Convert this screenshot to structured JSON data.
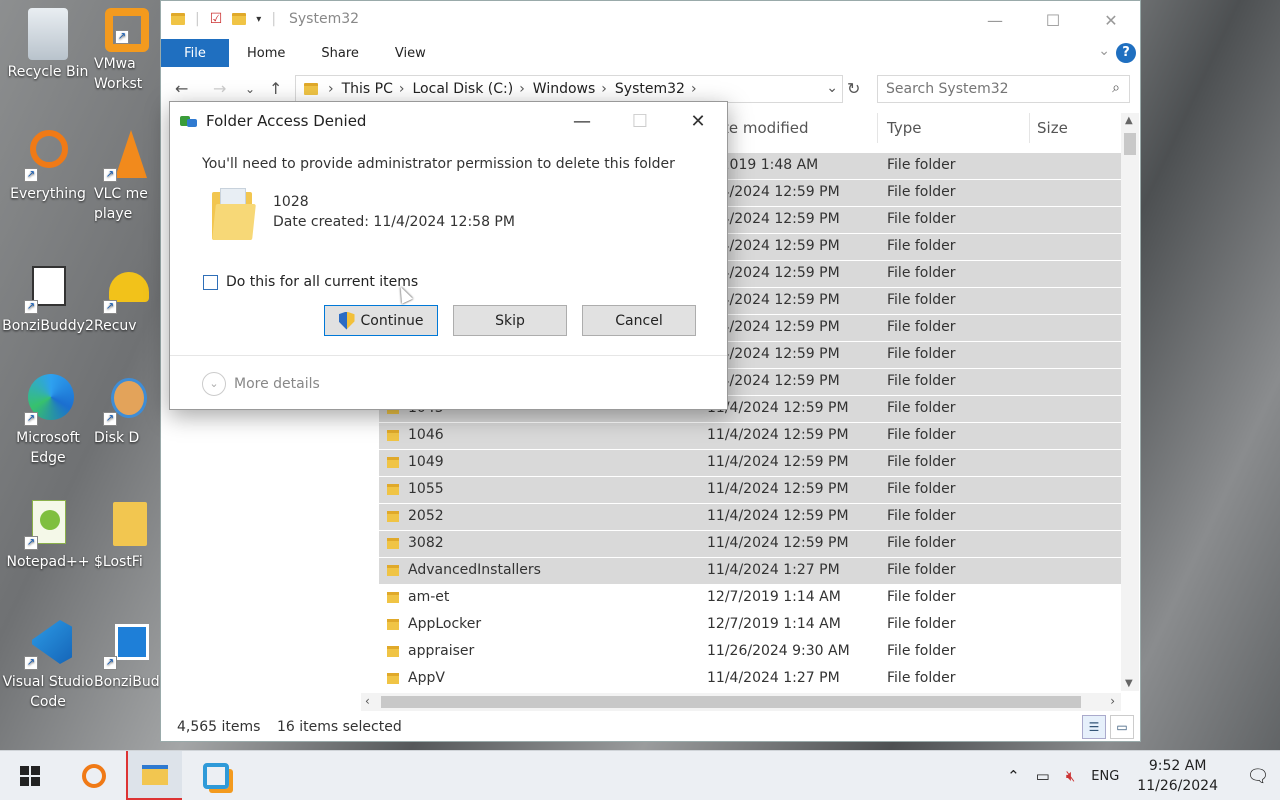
{
  "desktop": {
    "icons": [
      {
        "label": "Recycle Bin"
      },
      {
        "label": "VMwa Workst"
      },
      {
        "label": "Everything"
      },
      {
        "label": "VLC me playe"
      },
      {
        "label": "BonziBuddy2"
      },
      {
        "label": "Recuv"
      },
      {
        "label": "Microsoft Edge"
      },
      {
        "label": "Disk D"
      },
      {
        "label": "Notepad++"
      },
      {
        "label": "$LostFi"
      },
      {
        "label": "Visual Studio Code"
      },
      {
        "label": "BonziBud"
      }
    ]
  },
  "explorer": {
    "title": "System32",
    "ribbon": {
      "file": "File",
      "home": "Home",
      "share": "Share",
      "view": "View"
    },
    "breadcrumb": [
      "This PC",
      "Local Disk (C:)",
      "Windows",
      "System32"
    ],
    "search_placeholder": "Search System32",
    "columns": {
      "date": "te modified",
      "type": "Type",
      "size": "Size"
    },
    "rows": [
      {
        "name": "",
        "date": "7/2019 1:48 AM",
        "type": "File folder",
        "selected": true
      },
      {
        "name": "",
        "date": "1/4/2024 12:59 PM",
        "type": "File folder",
        "selected": true
      },
      {
        "name": "",
        "date": "1/4/2024 12:59 PM",
        "type": "File folder",
        "selected": true
      },
      {
        "name": "",
        "date": "1/4/2024 12:59 PM",
        "type": "File folder",
        "selected": true
      },
      {
        "name": "",
        "date": "1/4/2024 12:59 PM",
        "type": "File folder",
        "selected": true
      },
      {
        "name": "",
        "date": "1/4/2024 12:59 PM",
        "type": "File folder",
        "selected": true
      },
      {
        "name": "",
        "date": "1/4/2024 12:59 PM",
        "type": "File folder",
        "selected": true
      },
      {
        "name": "",
        "date": "1/4/2024 12:59 PM",
        "type": "File folder",
        "selected": true
      },
      {
        "name": "",
        "date": "1/4/2024 12:59 PM",
        "type": "File folder",
        "selected": true
      },
      {
        "name": "1045",
        "date": "11/4/2024 12:59 PM",
        "type": "File folder",
        "selected": true
      },
      {
        "name": "1046",
        "date": "11/4/2024 12:59 PM",
        "type": "File folder",
        "selected": true
      },
      {
        "name": "1049",
        "date": "11/4/2024 12:59 PM",
        "type": "File folder",
        "selected": true
      },
      {
        "name": "1055",
        "date": "11/4/2024 12:59 PM",
        "type": "File folder",
        "selected": true
      },
      {
        "name": "2052",
        "date": "11/4/2024 12:59 PM",
        "type": "File folder",
        "selected": true
      },
      {
        "name": "3082",
        "date": "11/4/2024 12:59 PM",
        "type": "File folder",
        "selected": true
      },
      {
        "name": "AdvancedInstallers",
        "date": "11/4/2024 1:27 PM",
        "type": "File folder",
        "selected": true
      },
      {
        "name": "am-et",
        "date": "12/7/2019 1:14 AM",
        "type": "File folder",
        "selected": false
      },
      {
        "name": "AppLocker",
        "date": "12/7/2019 1:14 AM",
        "type": "File folder",
        "selected": false
      },
      {
        "name": "appraiser",
        "date": "11/26/2024 9:30 AM",
        "type": "File folder",
        "selected": false
      },
      {
        "name": "AppV",
        "date": "11/4/2024 1:27 PM",
        "type": "File folder",
        "selected": false
      }
    ],
    "status": {
      "count": "4,565 items",
      "selected": "16 items selected"
    }
  },
  "dialog": {
    "title": "Folder Access Denied",
    "message": "You'll need to provide administrator permission to delete this folder",
    "item_name": "1028",
    "item_date": "Date created: 11/4/2024 12:58 PM",
    "checkbox_label": "Do this for all current items",
    "continue": "Continue",
    "skip": "Skip",
    "cancel": "Cancel",
    "more_details": "More details"
  },
  "taskbar": {
    "lang": "ENG",
    "time": "9:52 AM",
    "date": "11/26/2024"
  }
}
